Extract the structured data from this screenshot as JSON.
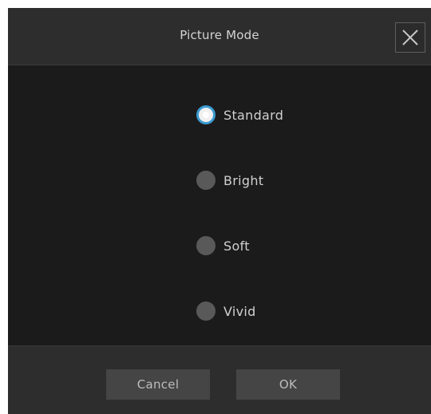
{
  "dialog": {
    "title": "Picture Mode",
    "close_icon": "close-icon"
  },
  "options": [
    {
      "label": "Standard",
      "selected": true
    },
    {
      "label": "Bright",
      "selected": false
    },
    {
      "label": "Soft",
      "selected": false
    },
    {
      "label": "Vivid",
      "selected": false
    }
  ],
  "buttons": {
    "cancel_label": "Cancel",
    "ok_label": "OK"
  },
  "colors": {
    "accent": "#3a9ad0",
    "background": "#1b1b1b",
    "bar": "#2d2d2d",
    "button": "#454545"
  }
}
